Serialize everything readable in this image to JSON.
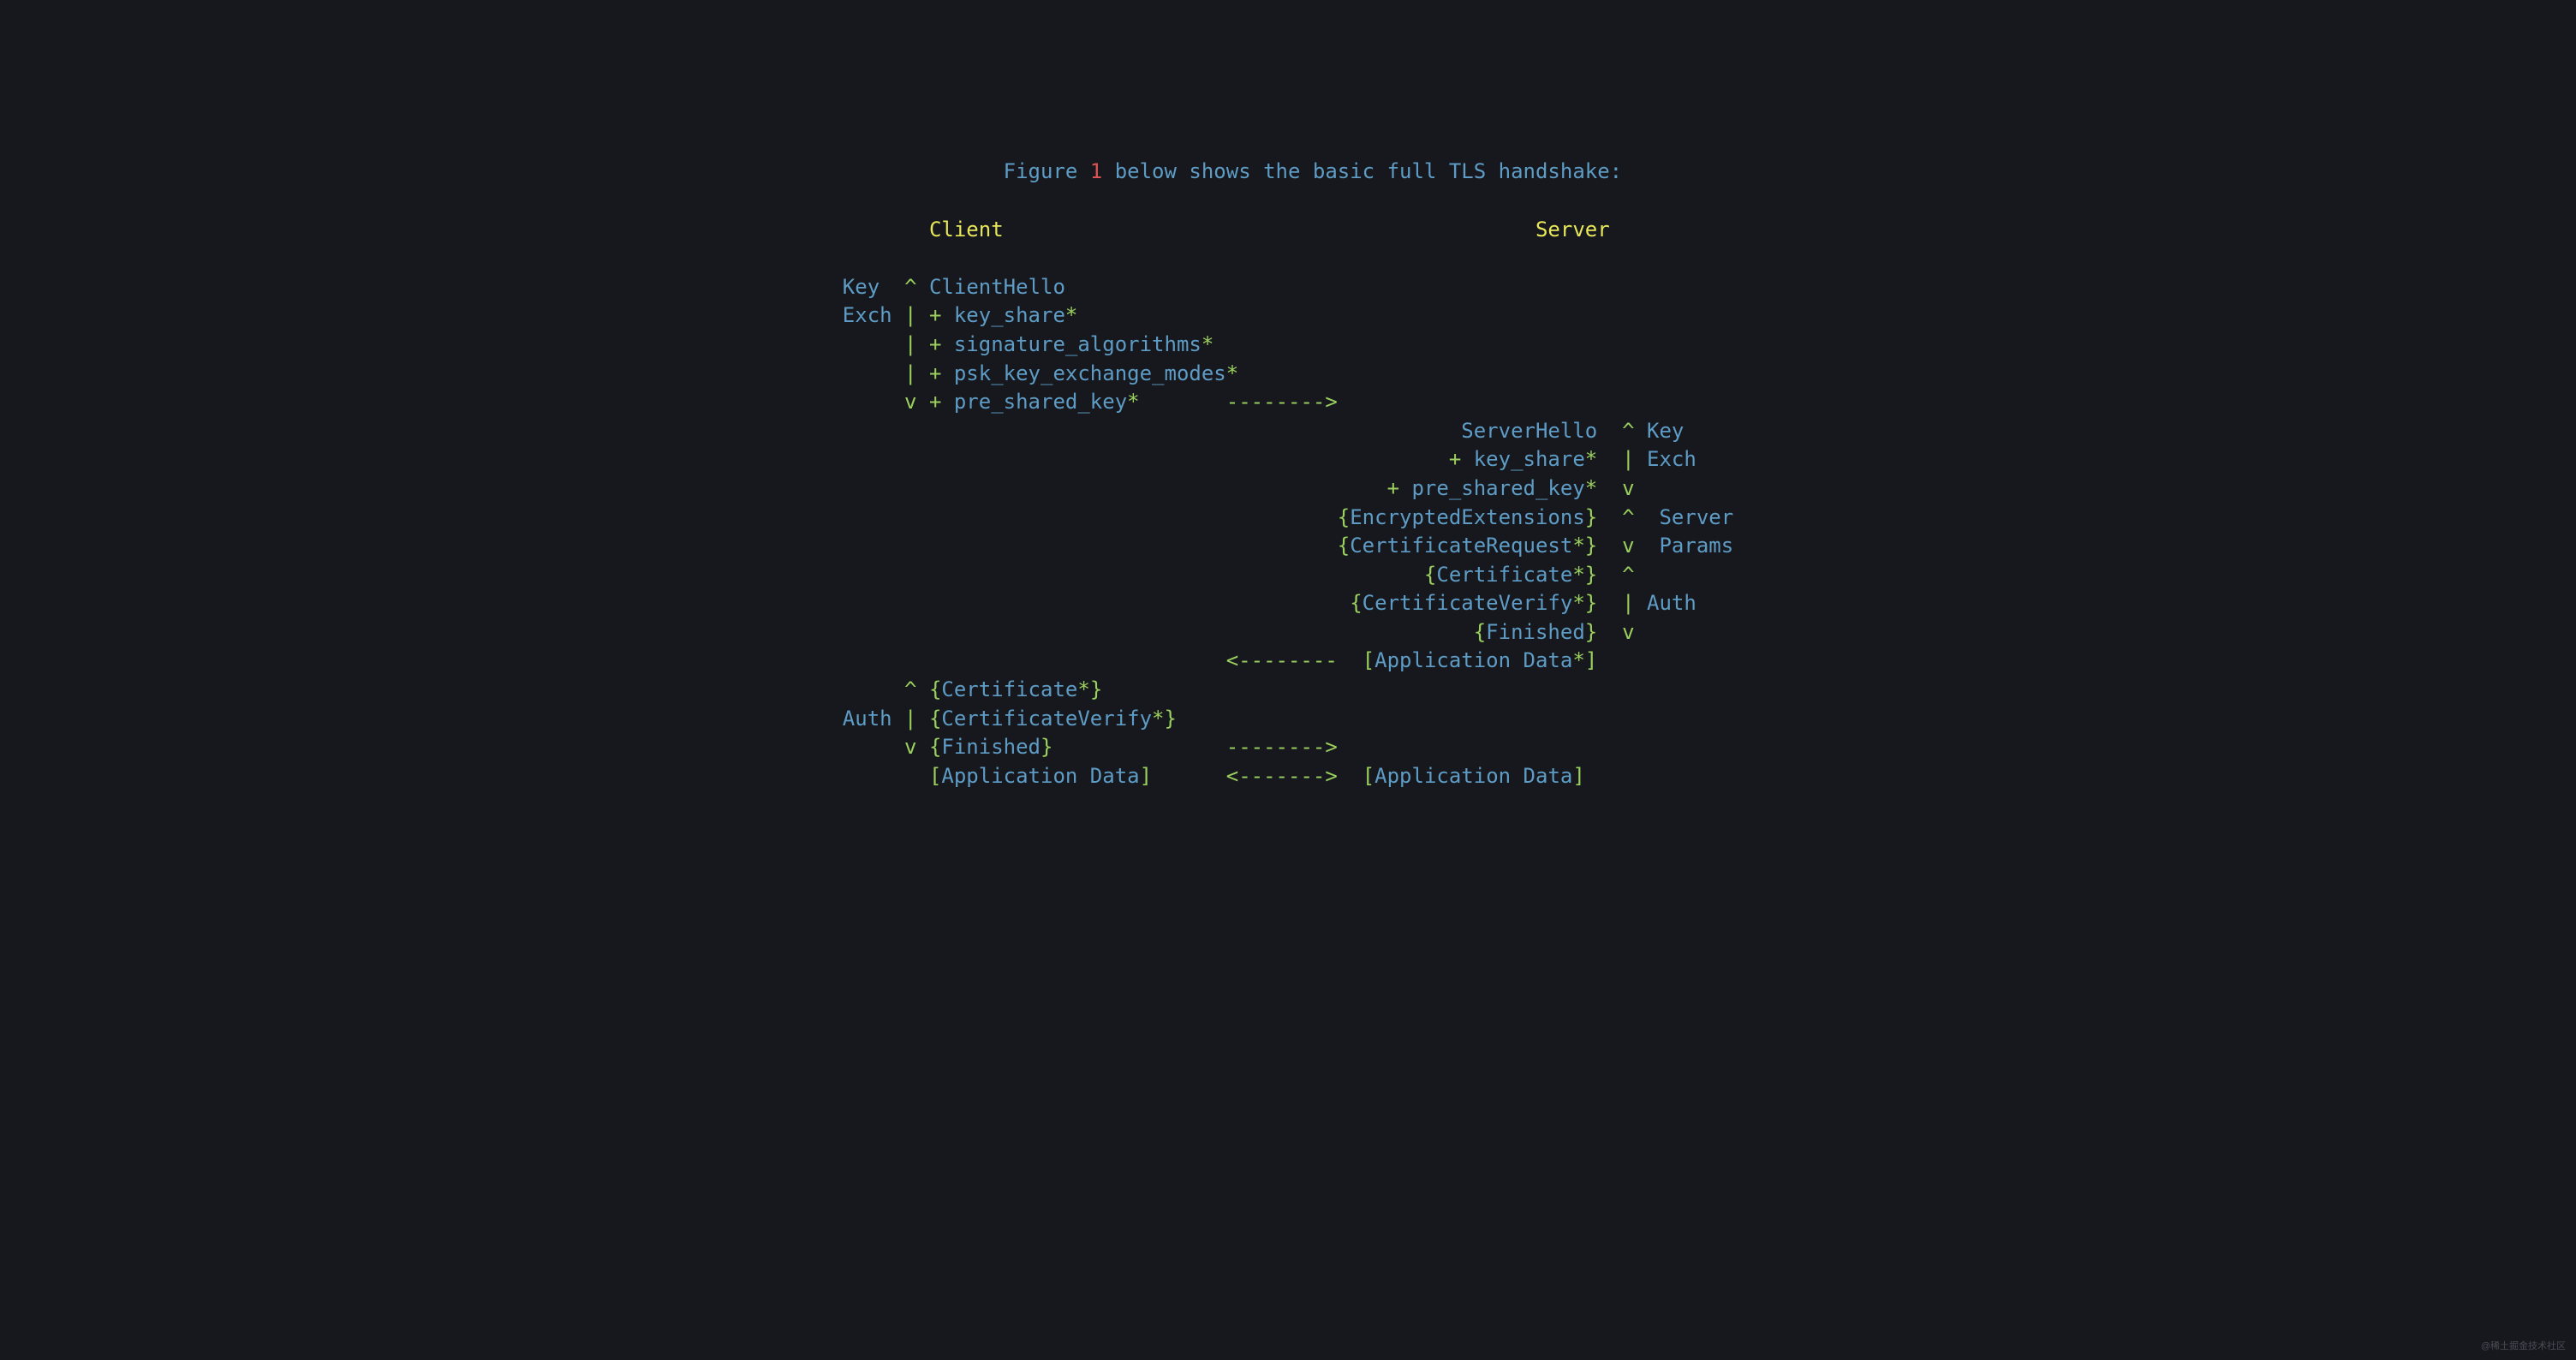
{
  "title": {
    "prefix": "Figure ",
    "num": "1",
    "suffix": " below shows the basic full TLS handshake:"
  },
  "headers": {
    "client": "Client",
    "server": "Server"
  },
  "annotations": {
    "key_left": "Key",
    "exch_left": "Exch",
    "auth_left": "Auth",
    "key_right": "Key",
    "exch_right": "Exch",
    "server_right": "Server",
    "params_right": "Params",
    "auth_right": "Auth"
  },
  "markers": {
    "caret": "^",
    "pipe": "|",
    "vdown": "v",
    "plus": "+",
    "star": "*",
    "lbrace": "{",
    "rbrace": "}",
    "lbrack": "[",
    "rbrack": "]",
    "arrow_r": "-------->",
    "arrow_l": "<--------",
    "arrow_lr": "<------->"
  },
  "messages": {
    "client_hello": "ClientHello",
    "key_share": "key_share",
    "signature_algorithms": "signature_algorithms",
    "psk_key_exchange_modes": "psk_key_exchange_modes",
    "pre_shared_key": "pre_shared_key",
    "server_hello": "ServerHello",
    "encrypted_extensions": "EncryptedExtensions",
    "certificate_request": "CertificateRequest",
    "certificate": "Certificate",
    "certificate_verify": "CertificateVerify",
    "finished": "Finished",
    "application_data": "Application Data"
  },
  "watermark": "@稀土掘金技术社区"
}
